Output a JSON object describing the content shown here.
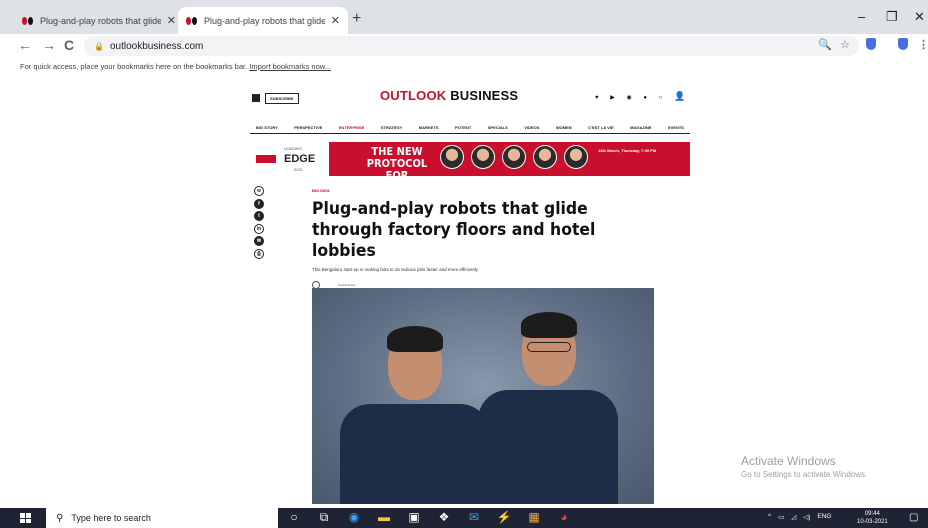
{
  "browser": {
    "tabs": [
      {
        "title": "Plug-and-play robots that glide",
        "active": false
      },
      {
        "title": "Plug-and-play robots that glide",
        "active": true
      }
    ],
    "new_tab": "+",
    "window_controls": {
      "minimize": "–",
      "maximize": "❐",
      "close": "✕"
    },
    "nav": {
      "back": "←",
      "forward": "→",
      "reload": "C"
    },
    "url": "outlookbusiness.com",
    "bookmark_hint": "For quick access, place your bookmarks here on the bookmarks bar.",
    "bookmark_link": "Import bookmarks now..."
  },
  "site": {
    "subscribe": "SUBSCRIBE",
    "logo_part1": "OUTLOOK",
    "logo_part2": " BUSINESS",
    "nav_items": [
      "BIG STORY",
      "PERSPECTIVE",
      "ENTERPRISE",
      "STRATEGY",
      "MARKETS",
      "POTENT",
      "SPECIALS",
      "VIDEOS",
      "WOMEN",
      "C'EST LA VIE",
      "MAGAZINE",
      "EVENTS"
    ],
    "banner": {
      "leading": "LEADING",
      "edge": "EDGE",
      "year": "2021",
      "headline1": "THE NEW PROTOCOL",
      "headline2": "FOR HEALTHCARE",
      "date": "11th March, Thursday, 7:00 PM"
    },
    "article": {
      "kicker": "BIG IDEA",
      "title": "Plug-and-play robots that glide through factory floors and hotel lobbies",
      "dek": "This Bengaluru start-up is making bots to do tedious jobs faster and more efficiently",
      "author": "Snehal Rane"
    }
  },
  "watermark": {
    "line1": "Activate Windows",
    "line2": "Go to Settings to activate Windows."
  },
  "taskbar": {
    "search_placeholder": "Type here to search",
    "lang": "ENG",
    "time": "09:44",
    "date": "10-03-2021"
  }
}
